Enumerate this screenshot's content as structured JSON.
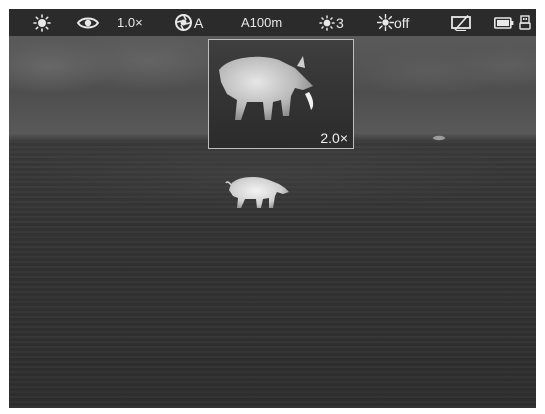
{
  "status_bar": {
    "brightness_icon": "sun-icon",
    "mode_icon": "eye-icon",
    "digital_zoom": "1.0×",
    "calibration_icon": "shutter-icon",
    "calibration_mode": "A",
    "amplification": "A100m",
    "contrast_icon": "contrast-sun-icon",
    "contrast_level": "3",
    "illuminator_icon": "ir-illuminator-icon",
    "illuminator_state": "off",
    "display_icon": "display-off-icon",
    "battery_icon": "battery-icon",
    "usb_icon": "usb-icon"
  },
  "pip": {
    "zoom": "2.0×"
  },
  "colors": {
    "bar_background": "#2b2b2b",
    "icon_color": "#e8e8e8",
    "pip_border": "#bdbdbd"
  }
}
